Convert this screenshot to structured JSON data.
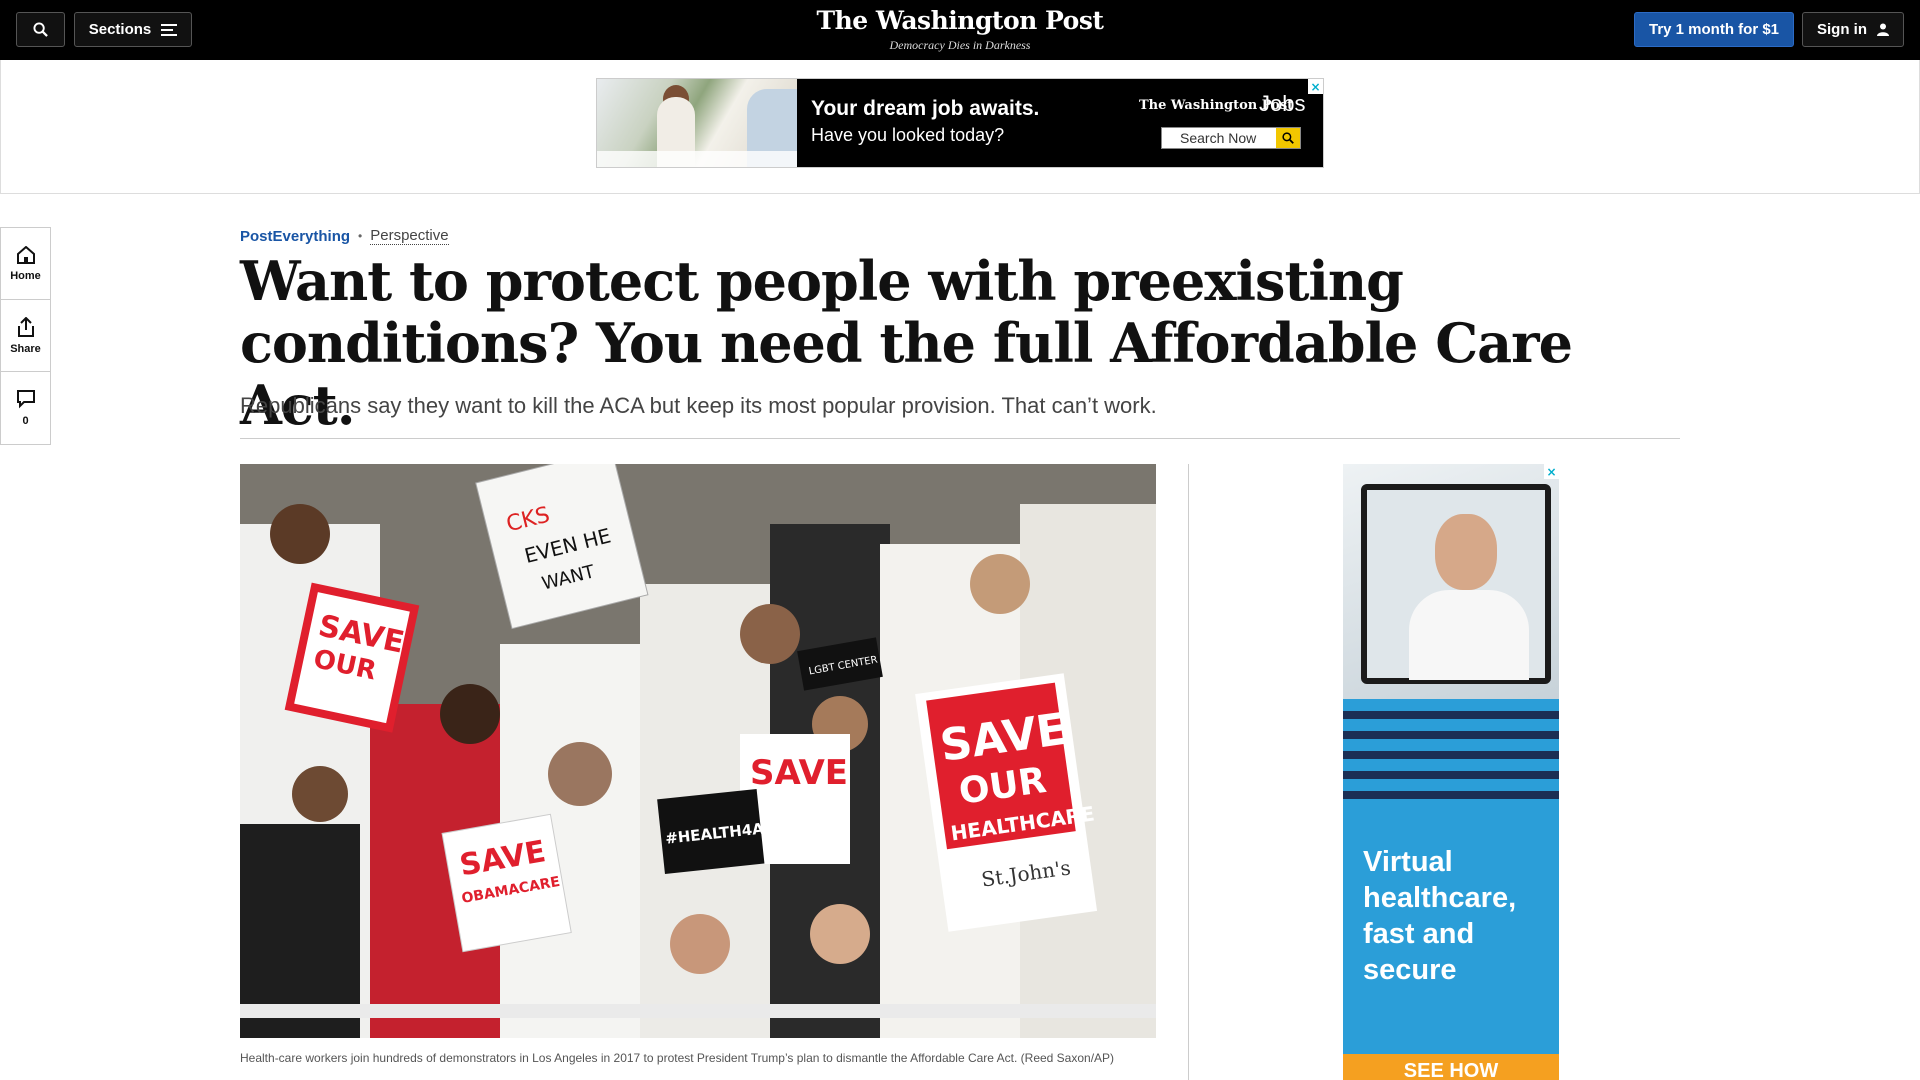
{
  "topnav": {
    "sections_label": "Sections",
    "logo_name": "The Washington Post",
    "logo_tagline": "Democracy Dies in Darkness",
    "subscribe_label": "Try 1 month for $1",
    "signin_label": "Sign in"
  },
  "banner_ad": {
    "headline": "Your dream job awaits.",
    "subline": "Have you looked today?",
    "brand": "The Washington Post",
    "brand_product": "Jobs",
    "search_label": "Search Now"
  },
  "rail": {
    "home_label": "Home",
    "share_label": "Share",
    "comments_count": "0"
  },
  "article": {
    "section": "PostEverything",
    "label": "Perspective",
    "headline": "Want to protect people with preexisting conditions? You need the full Affordable Care Act.",
    "dek": "Republicans say they want to kill the ACA but keep its most popular provision. That can’t work.",
    "caption": "Health-care workers join hundreds of demonstrators in Los Angeles in 2017 to protest President Trump’s plan to dismantle the Affordable Care Act. (Reed Saxon/AP)",
    "photo_signs": [
      "SAVE OUR HEALTHCARE",
      "SAVE OUR HEALTHCARE",
      "SAVE OUR HEALTHCARE",
      "SAVE OBAMACARE",
      "#HEALTH4ALL",
      "St. John's",
      "LGBT CENTER"
    ]
  },
  "side_ad": {
    "text": "Virtual healthcare, fast and secure",
    "cta": "SEE HOW"
  },
  "colors": {
    "nav_bg": "#000000",
    "accent_blue": "#1955a5",
    "ad_blue": "#2b9ed8",
    "sign_red": "#e01f2d"
  },
  "icons": [
    "search-icon",
    "menu-icon",
    "user-icon",
    "home-icon",
    "share-icon",
    "comment-icon",
    "ad-choices-icon"
  ]
}
